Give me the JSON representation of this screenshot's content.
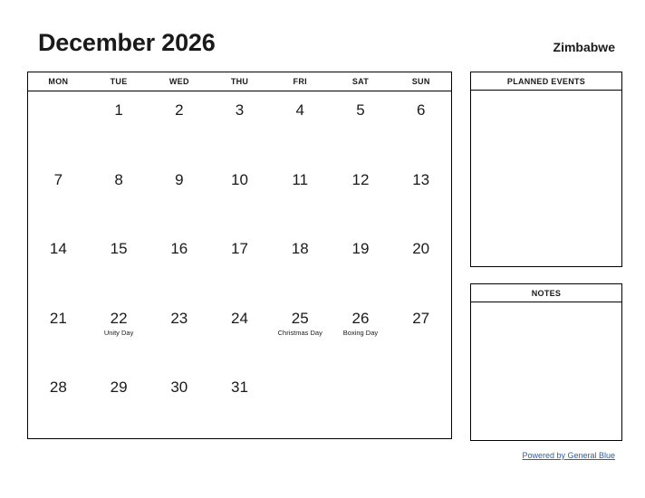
{
  "header": {
    "title": "December 2026",
    "country": "Zimbabwe"
  },
  "calendar": {
    "weekdays": [
      "MON",
      "TUE",
      "WED",
      "THU",
      "FRI",
      "SAT",
      "SUN"
    ],
    "weeks": [
      [
        {
          "day": "",
          "event": ""
        },
        {
          "day": "1",
          "event": ""
        },
        {
          "day": "2",
          "event": ""
        },
        {
          "day": "3",
          "event": ""
        },
        {
          "day": "4",
          "event": ""
        },
        {
          "day": "5",
          "event": ""
        },
        {
          "day": "6",
          "event": ""
        }
      ],
      [
        {
          "day": "7",
          "event": ""
        },
        {
          "day": "8",
          "event": ""
        },
        {
          "day": "9",
          "event": ""
        },
        {
          "day": "10",
          "event": ""
        },
        {
          "day": "11",
          "event": ""
        },
        {
          "day": "12",
          "event": ""
        },
        {
          "day": "13",
          "event": ""
        }
      ],
      [
        {
          "day": "14",
          "event": ""
        },
        {
          "day": "15",
          "event": ""
        },
        {
          "day": "16",
          "event": ""
        },
        {
          "day": "17",
          "event": ""
        },
        {
          "day": "18",
          "event": ""
        },
        {
          "day": "19",
          "event": ""
        },
        {
          "day": "20",
          "event": ""
        }
      ],
      [
        {
          "day": "21",
          "event": ""
        },
        {
          "day": "22",
          "event": "Unity Day"
        },
        {
          "day": "23",
          "event": ""
        },
        {
          "day": "24",
          "event": ""
        },
        {
          "day": "25",
          "event": "Christmas Day"
        },
        {
          "day": "26",
          "event": "Boxing Day"
        },
        {
          "day": "27",
          "event": ""
        }
      ],
      [
        {
          "day": "28",
          "event": ""
        },
        {
          "day": "29",
          "event": ""
        },
        {
          "day": "30",
          "event": ""
        },
        {
          "day": "31",
          "event": ""
        },
        {
          "day": "",
          "event": ""
        },
        {
          "day": "",
          "event": ""
        },
        {
          "day": "",
          "event": ""
        }
      ]
    ]
  },
  "panels": {
    "planned_events_title": "PLANNED EVENTS",
    "planned_events_content": "",
    "notes_title": "NOTES",
    "notes_content": ""
  },
  "footer": {
    "link_label": "Powered by General Blue"
  },
  "colors": {
    "text": "#1a1a1a",
    "border": "#000000",
    "link": "#2b5fa8",
    "background": "#ffffff"
  }
}
